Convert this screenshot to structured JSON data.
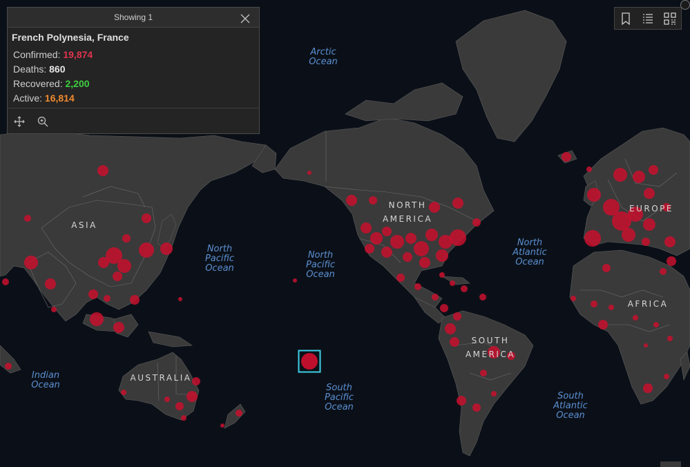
{
  "popup": {
    "header": "Showing 1",
    "title": "French Polynesia, France",
    "rows": [
      {
        "label": "Confirmed:",
        "value": "19,874",
        "color": "#e0344e"
      },
      {
        "label": "Deaths:",
        "value": "860",
        "color": "#e6e6e6"
      },
      {
        "label": "Recovered:",
        "value": "2,200",
        "color": "#3fcf3f"
      },
      {
        "label": "Active:",
        "value": "16,814",
        "color": "#f08a2e"
      }
    ]
  },
  "toolbar": {
    "icons": [
      "bookmark-icon",
      "list-icon",
      "qr-grid-icon"
    ]
  },
  "map": {
    "land_color": "#3a3a3a",
    "border_color": "#6e6e6e",
    "ocean_color": "#0b1018",
    "bubble_color": "#c8102e",
    "selection_color": "#3fd0e8",
    "ocean_labels": [
      {
        "id": "arctic",
        "text": "Arctic\nOcean"
      },
      {
        "id": "north-pacific-west",
        "text": "North\nPacific\nOcean"
      },
      {
        "id": "north-pacific-center",
        "text": "North\nPacific\nOcean"
      },
      {
        "id": "north-atlantic",
        "text": "North\nAtlantic\nOcean"
      },
      {
        "id": "indian",
        "text": "Indian\nOcean"
      },
      {
        "id": "south-pacific",
        "text": "South\nPacific\nOcean"
      },
      {
        "id": "south-atlantic",
        "text": "South\nAtlantic\nOcean"
      }
    ],
    "region_labels": [
      {
        "id": "asia",
        "text": "ASIA"
      },
      {
        "id": "north-america",
        "text": "NORTH\nAMERICA"
      },
      {
        "id": "europe",
        "text": "EUROPE"
      },
      {
        "id": "africa",
        "text": "AFRICA"
      },
      {
        "id": "south-america",
        "text": "SOUTH\nAMERICA"
      },
      {
        "id": "australia",
        "text": "AUSTRALIA"
      }
    ]
  }
}
